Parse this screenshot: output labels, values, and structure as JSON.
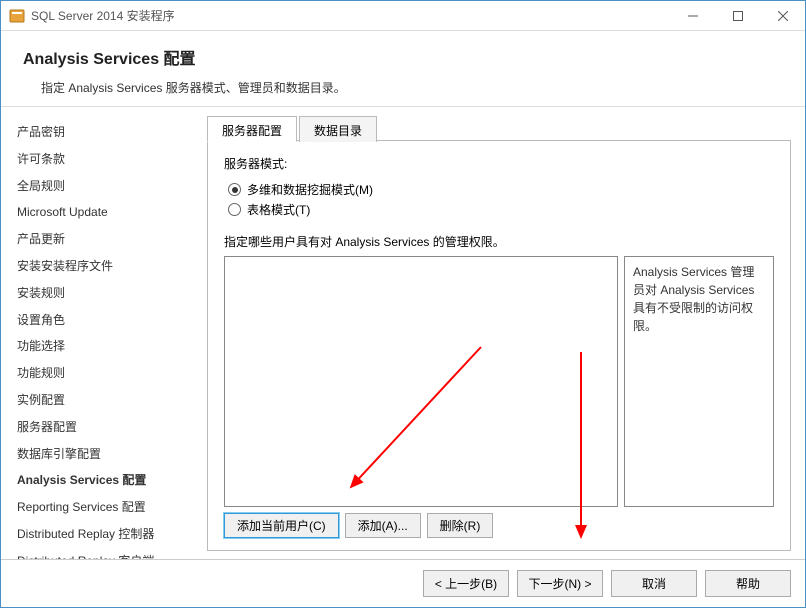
{
  "window": {
    "title": "SQL Server 2014 安装程序"
  },
  "header": {
    "title": "Analysis  Services 配置",
    "subtitle": "指定 Analysis Services 服务器模式、管理员和数据目录。"
  },
  "sidebar": {
    "items": [
      "产品密钥",
      "许可条款",
      "全局规则",
      "Microsoft Update",
      "产品更新",
      "安装安装程序文件",
      "安装规则",
      "设置角色",
      "功能选择",
      "功能规则",
      "实例配置",
      "服务器配置",
      "数据库引擎配置",
      "Analysis Services 配置",
      "Reporting Services 配置",
      "Distributed Replay 控制器",
      "Distributed Replay 客户端"
    ],
    "current_index": 13
  },
  "tabs": {
    "items": [
      "服务器配置",
      "数据目录"
    ],
    "active_index": 0
  },
  "server_config": {
    "mode_label": "服务器模式:",
    "options": [
      {
        "label": "多维和数据挖掘模式(M)",
        "checked": true
      },
      {
        "label": "表格模式(T)",
        "checked": false
      }
    ],
    "perm_desc": "指定哪些用户具有对 Analysis Services 的管理权限。",
    "info_text": "Analysis Services 管理员对 Analysis Services 具有不受限制的访问权限。",
    "buttons": {
      "add_current": "添加当前用户(C)",
      "add": "添加(A)...",
      "remove": "删除(R)"
    }
  },
  "footer": {
    "back": "< 上一步(B)",
    "next": "下一步(N) >",
    "cancel": "取消",
    "help": "帮助"
  }
}
